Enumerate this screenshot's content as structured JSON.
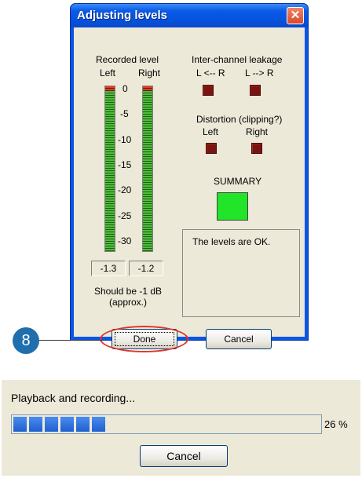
{
  "dialog": {
    "title": "Adjusting levels",
    "close_glyph": "✕",
    "recorded_level_label": "Recorded level",
    "left_label": "Left",
    "right_label": "Right",
    "scale_ticks": [
      "0",
      "-5",
      "-10",
      "-15",
      "-20",
      "-25",
      "-30"
    ],
    "left_value": "-1.3",
    "right_value": "-1.2",
    "should_be_line1": "Should be  -1 dB",
    "should_be_line2": "(approx.)",
    "leakage_label": "Inter-channel leakage",
    "leak_l_label": "L <-- R",
    "leak_r_label": "L --> R",
    "distortion_label": "Distortion (clipping?)",
    "dist_left_label": "Left",
    "dist_right_label": "Right",
    "summary_label": "SUMMARY",
    "summary_color": "#22e52a",
    "indicator_color": "#7a1410",
    "message": "The levels are OK.",
    "done_label": "Done",
    "cancel_label": "Cancel"
  },
  "callout": {
    "step": "8",
    "highlight_color": "#e0352a",
    "badge_color": "#1f6fae"
  },
  "progress": {
    "title": "Playback and recording...",
    "percent": 26,
    "percent_text": "26 %",
    "cancel_label": "Cancel",
    "bar_color": "#2a6ee0"
  }
}
